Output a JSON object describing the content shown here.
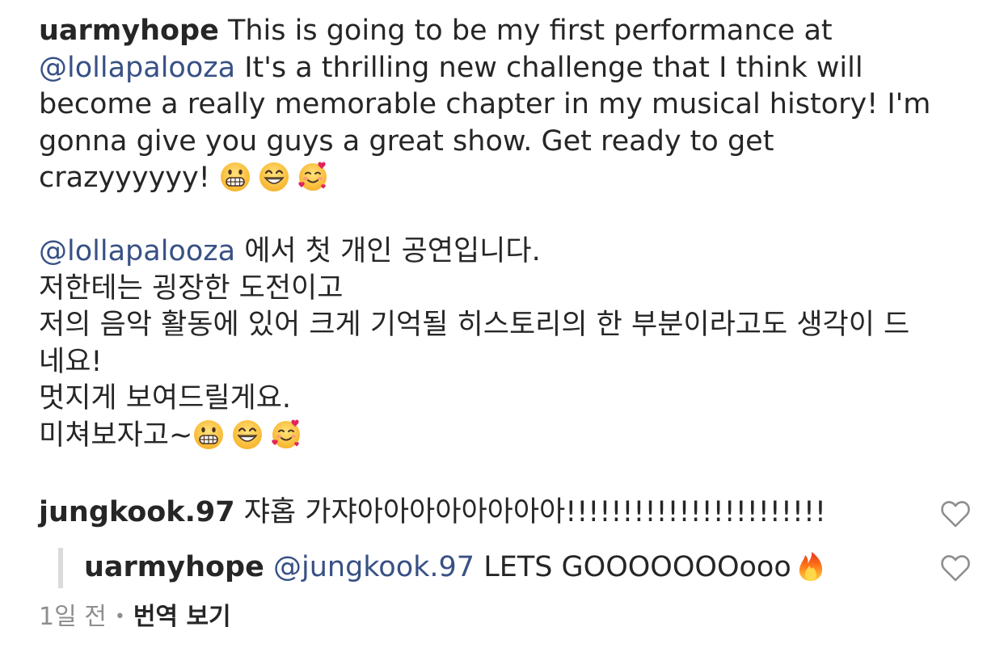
{
  "post": {
    "username": "uarmyhope",
    "en_line1_text": " This is going to be my first performance at",
    "mention": "@lollapalooza",
    "en_line2_text": " It's a thrilling new challenge that I think will",
    "en_line3": "become a really memorable chapter in my musical history! I'm",
    "en_line4": "gonna give you guys a great show. Get ready to get",
    "en_line5_text": "crazyyyyyy! ",
    "ko_line1_text": " 에서 첫 개인 공연입니다.",
    "ko_line2": "저한테는 굉장한 도전이고",
    "ko_line3": "저의 음악 활동에 있어 크게 기억될 히스토리의 한 부분이라고도 생각이 드",
    "ko_line4": "네요!",
    "ko_line5": "멋지게 보여드릴게요.",
    "ko_line6_text": "미쳐보자고~",
    "emojis": [
      "grimacing-face",
      "grinning-face-smiling-eyes",
      "smiling-face-with-hearts"
    ]
  },
  "comments": [
    {
      "username": "jungkook.97",
      "text": " 쟈홉 가쟈아아아아아아아아!!!!!!!!!!!!!!!!!!!!!!!",
      "icon": "heart-outline-icon"
    }
  ],
  "reply": {
    "username": "uarmyhope",
    "mention": "@jungkook.97",
    "text": " LETS GOOOOOOOooo",
    "emoji": "fire",
    "icon": "heart-outline-icon"
  },
  "meta": {
    "time": "1일 전",
    "separator": "•",
    "translate_label": "번역 보기"
  },
  "colors": {
    "text": "#262626",
    "mention": "#385185",
    "muted": "#8e8e8e",
    "reply_bar": "#dbdbdb"
  }
}
